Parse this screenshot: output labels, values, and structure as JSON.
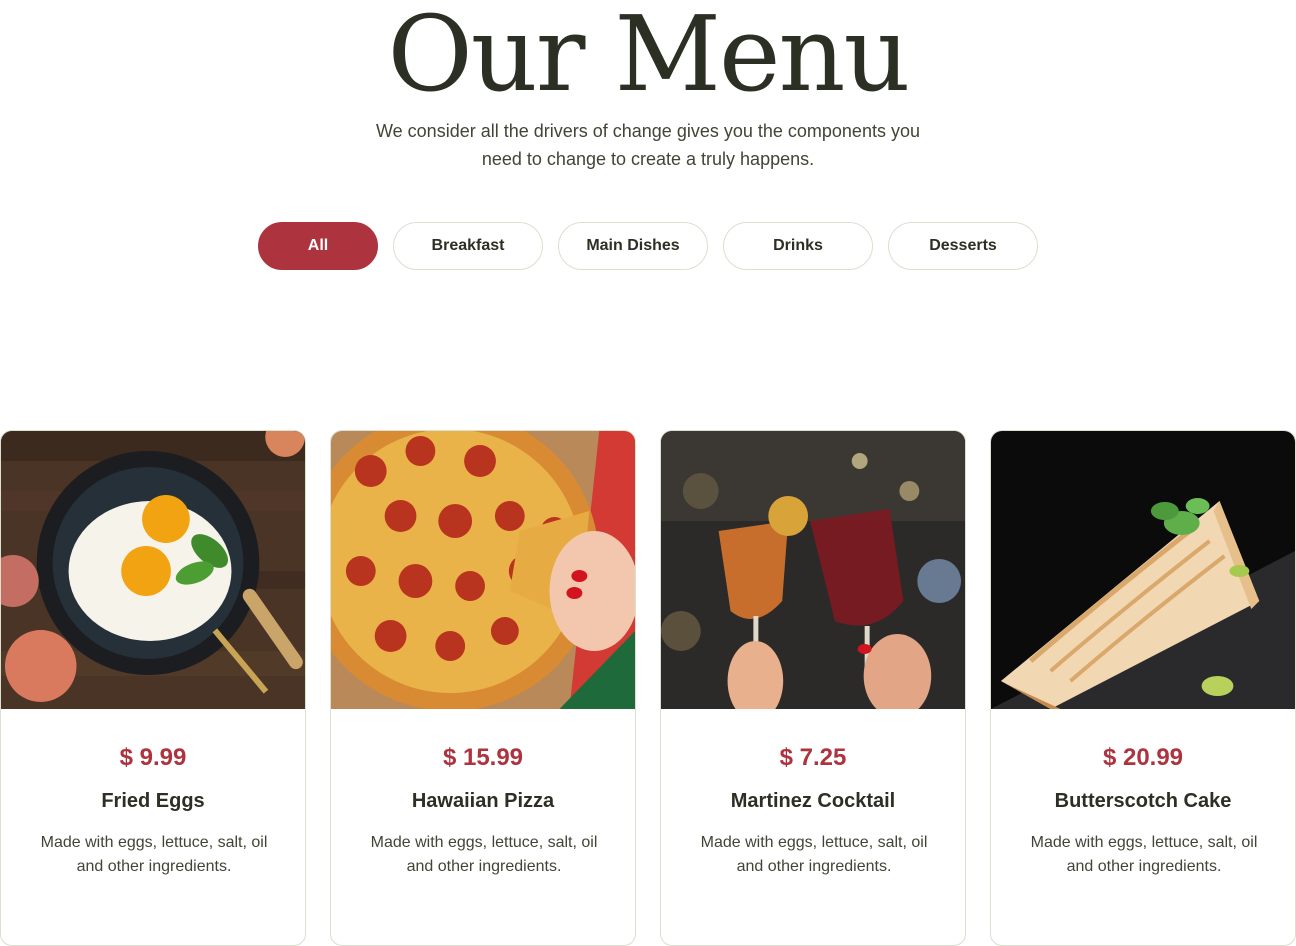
{
  "header": {
    "title": "Our Menu",
    "subtitle": "We consider all the drivers of change gives you the components you need to change to create a truly happens."
  },
  "filters": [
    {
      "label": "All",
      "active": true
    },
    {
      "label": "Breakfast",
      "active": false
    },
    {
      "label": "Main Dishes",
      "active": false
    },
    {
      "label": "Drinks",
      "active": false
    },
    {
      "label": "Desserts",
      "active": false
    }
  ],
  "colors": {
    "accent": "#ad343e",
    "text_dark": "#2c2f24",
    "border": "#dbdfd0"
  },
  "menu_items": [
    {
      "image": "fried-eggs-image",
      "price": "$ 9.99",
      "name": "Fried Eggs",
      "description": "Made with eggs, lettuce, salt, oil and other ingredients."
    },
    {
      "image": "pizza-image",
      "price": "$ 15.99",
      "name": "Hawaiian Pizza",
      "description": "Made with eggs, lettuce, salt, oil and other ingredients."
    },
    {
      "image": "cocktail-image",
      "price": "$ 7.25",
      "name": "Martinez Cocktail",
      "description": "Made with eggs, lettuce, salt, oil and other ingredients."
    },
    {
      "image": "cake-image",
      "price": "$ 20.99",
      "name": "Butterscotch Cake",
      "description": "Made with eggs, lettuce, salt, oil and other ingredients."
    }
  ]
}
